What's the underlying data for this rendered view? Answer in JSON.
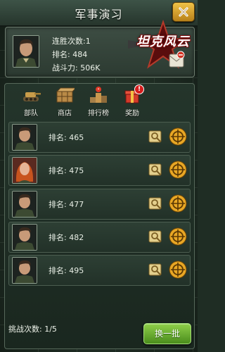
{
  "window": {
    "title": "军事演习"
  },
  "logo": {
    "text": "坦克风云"
  },
  "player": {
    "wins_label": "连胜次数:",
    "wins_value": "1",
    "rank_label": "排名:",
    "rank_value": "484",
    "power_label": "战斗力:",
    "power_value": "506K"
  },
  "menu": [
    {
      "label": "部队",
      "icon": "tank-icon"
    },
    {
      "label": "商店",
      "icon": "supply-crate-icon"
    },
    {
      "label": "排行榜",
      "icon": "ranking-trophy-icon"
    },
    {
      "label": "奖励",
      "icon": "gift-box-icon",
      "badge": "!"
    }
  ],
  "opponents": [
    {
      "rank_label": "排名:",
      "rank_value": "465",
      "avatar": "male-soldier"
    },
    {
      "rank_label": "排名:",
      "rank_value": "475",
      "avatar": "female-officer"
    },
    {
      "rank_label": "排名:",
      "rank_value": "477",
      "avatar": "male-soldier"
    },
    {
      "rank_label": "排名:",
      "rank_value": "482",
      "avatar": "male-soldier"
    },
    {
      "rank_label": "排名:",
      "rank_value": "495",
      "avatar": "male-soldier"
    }
  ],
  "footer": {
    "challenges_label": "挑战次数:",
    "challenges_value": "1/5",
    "refresh_label": "换一批"
  },
  "colors": {
    "accent_green": "#6fb43a",
    "gold": "#e0a32a",
    "panel": "#24352b"
  }
}
